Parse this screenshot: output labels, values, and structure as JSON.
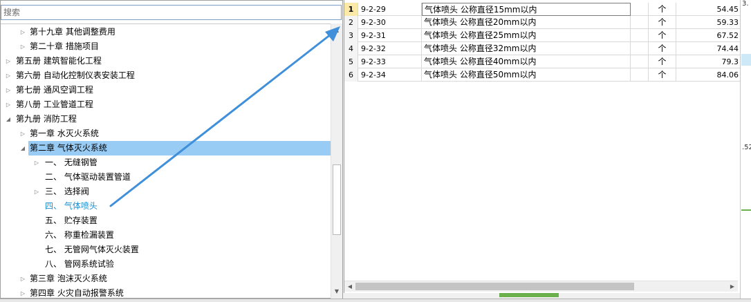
{
  "search": {
    "placeholder": "搜索"
  },
  "tree": [
    {
      "label": "第十九章 其他调整费用",
      "arrow": "▷"
    },
    {
      "label": "第二十章 措施项目",
      "arrow": "▷"
    },
    {
      "label": "第五册 建筑智能化工程",
      "arrow": "▷"
    },
    {
      "label": "第六册 自动化控制仪表安装工程",
      "arrow": "▷"
    },
    {
      "label": "第七册 通风空调工程",
      "arrow": "▷"
    },
    {
      "label": "第八册 工业管道工程",
      "arrow": "▷"
    },
    {
      "label": "第九册 消防工程",
      "arrow": "◢"
    },
    {
      "label": "第一章 水灭火系统",
      "arrow": "▷"
    },
    {
      "label": "第二章 气体灭火系统",
      "arrow": "◢"
    },
    {
      "label": "一、  无缝钢管",
      "arrow": "▷"
    },
    {
      "label": "二、  气体驱动装置管道",
      "arrow": ""
    },
    {
      "label": "三、  选择阀",
      "arrow": "▷"
    },
    {
      "label": "四、  气体喷头",
      "arrow": ""
    },
    {
      "label": "五、  贮存装置",
      "arrow": ""
    },
    {
      "label": "六、  称重检漏装置",
      "arrow": ""
    },
    {
      "label": "七、  无管网气体灭火装置",
      "arrow": ""
    },
    {
      "label": "八、  管网系统试验",
      "arrow": ""
    },
    {
      "label": "第三章 泡沫灭火系统",
      "arrow": "▷"
    },
    {
      "label": "第四章 火灾自动报警系统",
      "arrow": "▷"
    }
  ],
  "scrollbar": {
    "up": "▲",
    "down": "▼",
    "left": "◀",
    "right": "▶"
  },
  "table": {
    "rows": [
      {
        "idx": "1",
        "code": "9-2-29",
        "name": "气体喷头 公称直径15mm以内",
        "unit": "个",
        "price": "54.45"
      },
      {
        "idx": "2",
        "code": "9-2-30",
        "name": "气体喷头 公称直径20mm以内",
        "unit": "个",
        "price": "59.33"
      },
      {
        "idx": "3",
        "code": "9-2-31",
        "name": "气体喷头 公称直径25mm以内",
        "unit": "个",
        "price": "67.52"
      },
      {
        "idx": "4",
        "code": "9-2-32",
        "name": "气体喷头 公称直径32mm以内",
        "unit": "个",
        "price": "74.44"
      },
      {
        "idx": "5",
        "code": "9-2-33",
        "name": "气体喷头 公称直径40mm以内",
        "unit": "个",
        "price": "79.3"
      },
      {
        "idx": "6",
        "code": "9-2-34",
        "name": "气体喷头 公称直径50mm以内",
        "unit": "个",
        "price": "84.06"
      }
    ]
  },
  "splitter": {
    "grip": "⌃"
  },
  "far_right": {
    "top_text": "3.",
    "mid_text": ".52"
  },
  "colors": {
    "selected_row": "#99ccf5",
    "active_text": "#1a8fd0",
    "annotation_arrow": "#3f8fdb",
    "splitter": "#6ab04c"
  }
}
